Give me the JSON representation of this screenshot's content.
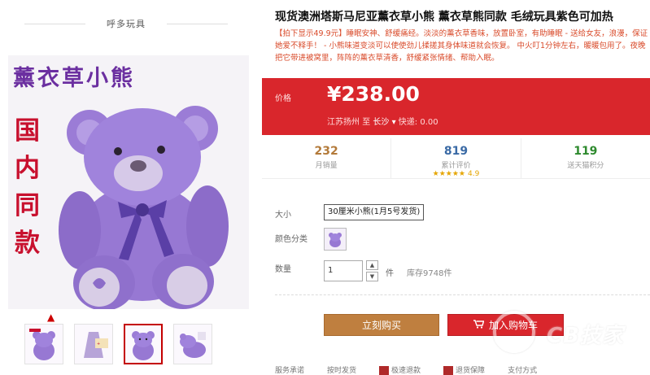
{
  "shop": {
    "name": "呼多玩具"
  },
  "gallery": {
    "overlay_title": "薰衣草小熊",
    "side_text": "国内同款",
    "thumbnails": [
      "thumb-1",
      "thumb-2",
      "thumb-3",
      "thumb-4"
    ],
    "active_thumbnail": 3
  },
  "product": {
    "title": "现货澳洲塔斯马尼亚薰衣草小熊 薰衣草熊同款 毛绒玩具紫色可加热",
    "promo": "【拍下显示49.9元】睡眠安神、舒缓痛经。淡淡的薰衣草香味，放置卧室，有助睡眠 - 送给女友，浪漫，保证她爱不释手！ - 小熊味道变淡可以使使劲儿揉搓其身体味道就会恢复。 中火叮1分钟左右，暖暖包用了。夜晚把它带进被窝里，阵阵的薰衣草清香，舒缓紧张情绪、帮助入眠。"
  },
  "price": {
    "label": "价格",
    "value": "¥238.00",
    "origin": "江苏扬州",
    "to": "至",
    "destination": "长沙",
    "shipping": "快递: 0.00"
  },
  "stats": {
    "monthly_sales": {
      "value": "232",
      "label": "月销量"
    },
    "reviews": {
      "value": "819",
      "label": "累计评价",
      "stars": "★★★★★",
      "score": "4.9"
    },
    "points": {
      "value": "119",
      "label": "送天猫积分"
    }
  },
  "options": {
    "size_label": "大小",
    "size_value": "30厘米小熊(1月5号发货)",
    "color_label": "颜色分类",
    "qty_label": "数量",
    "qty_value": "1",
    "qty_unit": "件",
    "stock": "库存9748件"
  },
  "actions": {
    "buy_now": "立刻购买",
    "add_to_cart": "加入购物车"
  },
  "service": [
    "服务承诺",
    "按时发货",
    "极速退款",
    "退货保障",
    "支付方式"
  ],
  "watermark": {
    "text": "CB技家"
  },
  "colors": {
    "price_bg": "#d9262c",
    "buy_btn": "#bf7f3f",
    "cart_btn": "#d9262c",
    "bear_purple": "#9b7cd6",
    "title_purple": "#6b2fa0",
    "side_red": "#c8102e"
  },
  "icons": [
    "chevron-up-icon",
    "chevron-down-icon",
    "cart-icon",
    "star-icon"
  ]
}
